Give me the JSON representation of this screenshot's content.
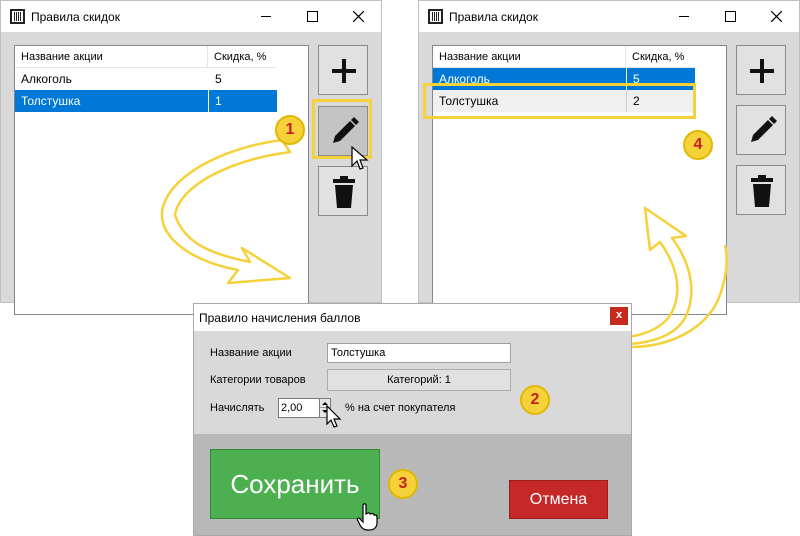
{
  "left_window": {
    "title": "Правила скидок",
    "columns": [
      "Название акции",
      "Скидка, %"
    ],
    "rows": [
      {
        "name": "Алкоголь",
        "discount": "5"
      },
      {
        "name": "Толстушка",
        "discount": "1"
      }
    ]
  },
  "right_window": {
    "title": "Правила скидок",
    "columns": [
      "Название акции",
      "Скидка, %"
    ],
    "rows": [
      {
        "name": "Алкоголь",
        "discount": "5"
      },
      {
        "name": "Толстушка",
        "discount": "2"
      }
    ]
  },
  "window_controls": {
    "close_glyph": "×"
  },
  "toolbar_icons": [
    "plus-icon",
    "pencil-icon",
    "trash-icon"
  ],
  "dialog": {
    "title": "Правило начисления баллов",
    "close_glyph": "x",
    "name_label": "Название акции",
    "name_value": "Толстушка",
    "categories_label": "Категории товаров",
    "categories_button": "Категорий: 1",
    "accrue_label": "Начислять",
    "accrue_value": "2,00",
    "accrue_suffix": "% на счет покупателя",
    "save_label": "Сохранить",
    "cancel_label": "Отмена"
  },
  "steps": [
    "1",
    "2",
    "3",
    "4"
  ],
  "colors": {
    "selection": "#0078d7",
    "highlight": "#f5d13a",
    "badge_text": "#c81e1e",
    "save": "#4caf50",
    "cancel": "#c62828"
  }
}
